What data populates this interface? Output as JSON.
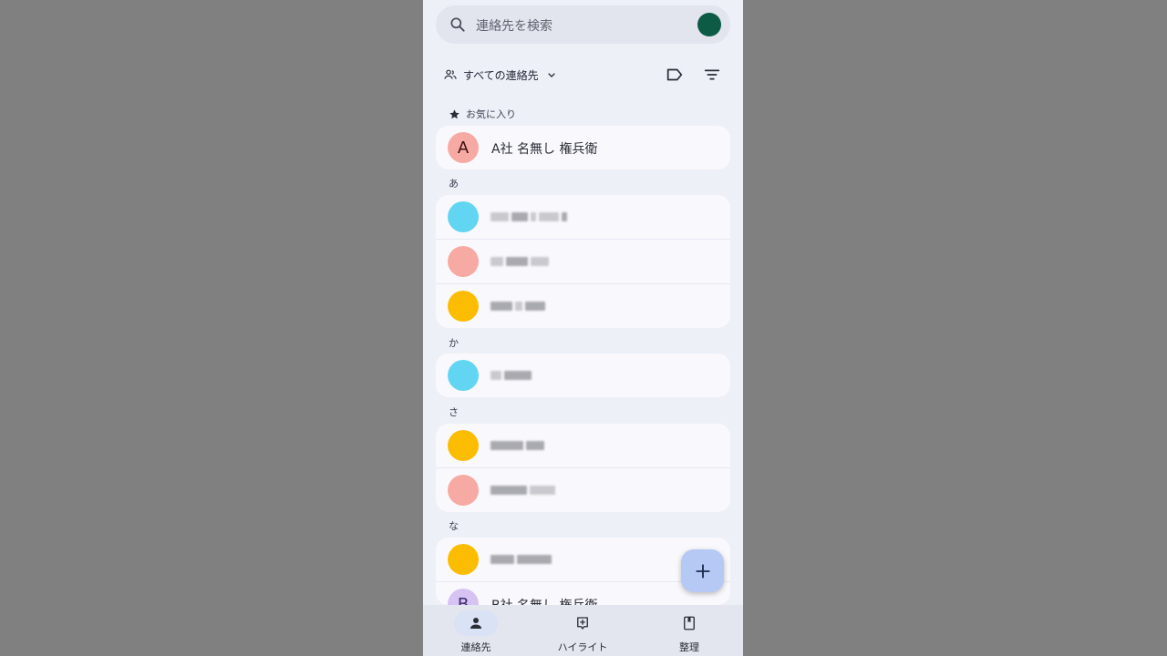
{
  "search": {
    "placeholder": "連絡先を検索"
  },
  "toolbar": {
    "filter_label": "すべての連絡先"
  },
  "sections": {
    "favorites": "お気に入り",
    "a": "あ",
    "ka": "か",
    "sa": "さ",
    "na": "な"
  },
  "contacts": {
    "fav1": {
      "initial": "A",
      "name": "A社 名無し 権兵衛",
      "color": "#f7aaa4"
    },
    "b1": {
      "initial": "B",
      "name": "B社 名無し 権兵衛",
      "color": "#d7c2f4"
    }
  },
  "colors": {
    "cyan": "#62d5f2",
    "pink": "#f7aaa4",
    "amber": "#fcbd00",
    "purple": "#d7c2f4",
    "fab": "#b6c8f4",
    "account": "#0d5a45"
  },
  "nav": {
    "contacts": "連絡先",
    "highlights": "ハイライト",
    "organize": "整理"
  }
}
